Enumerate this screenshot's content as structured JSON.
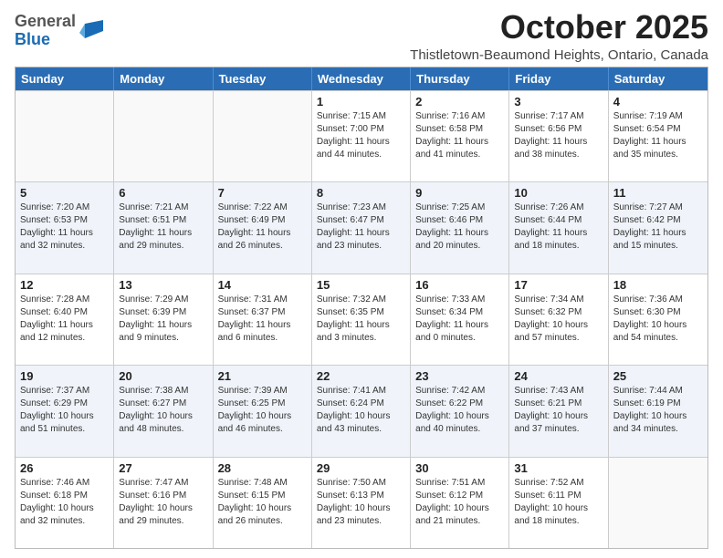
{
  "logo": {
    "general": "General",
    "blue": "Blue"
  },
  "title": "October 2025",
  "location": "Thistletown-Beaumond Heights, Ontario, Canada",
  "days_of_week": [
    "Sunday",
    "Monday",
    "Tuesday",
    "Wednesday",
    "Thursday",
    "Friday",
    "Saturday"
  ],
  "weeks": [
    [
      {
        "day": "",
        "info": ""
      },
      {
        "day": "",
        "info": ""
      },
      {
        "day": "",
        "info": ""
      },
      {
        "day": "1",
        "info": "Sunrise: 7:15 AM\nSunset: 7:00 PM\nDaylight: 11 hours and 44 minutes."
      },
      {
        "day": "2",
        "info": "Sunrise: 7:16 AM\nSunset: 6:58 PM\nDaylight: 11 hours and 41 minutes."
      },
      {
        "day": "3",
        "info": "Sunrise: 7:17 AM\nSunset: 6:56 PM\nDaylight: 11 hours and 38 minutes."
      },
      {
        "day": "4",
        "info": "Sunrise: 7:19 AM\nSunset: 6:54 PM\nDaylight: 11 hours and 35 minutes."
      }
    ],
    [
      {
        "day": "5",
        "info": "Sunrise: 7:20 AM\nSunset: 6:53 PM\nDaylight: 11 hours and 32 minutes."
      },
      {
        "day": "6",
        "info": "Sunrise: 7:21 AM\nSunset: 6:51 PM\nDaylight: 11 hours and 29 minutes."
      },
      {
        "day": "7",
        "info": "Sunrise: 7:22 AM\nSunset: 6:49 PM\nDaylight: 11 hours and 26 minutes."
      },
      {
        "day": "8",
        "info": "Sunrise: 7:23 AM\nSunset: 6:47 PM\nDaylight: 11 hours and 23 minutes."
      },
      {
        "day": "9",
        "info": "Sunrise: 7:25 AM\nSunset: 6:46 PM\nDaylight: 11 hours and 20 minutes."
      },
      {
        "day": "10",
        "info": "Sunrise: 7:26 AM\nSunset: 6:44 PM\nDaylight: 11 hours and 18 minutes."
      },
      {
        "day": "11",
        "info": "Sunrise: 7:27 AM\nSunset: 6:42 PM\nDaylight: 11 hours and 15 minutes."
      }
    ],
    [
      {
        "day": "12",
        "info": "Sunrise: 7:28 AM\nSunset: 6:40 PM\nDaylight: 11 hours and 12 minutes."
      },
      {
        "day": "13",
        "info": "Sunrise: 7:29 AM\nSunset: 6:39 PM\nDaylight: 11 hours and 9 minutes."
      },
      {
        "day": "14",
        "info": "Sunrise: 7:31 AM\nSunset: 6:37 PM\nDaylight: 11 hours and 6 minutes."
      },
      {
        "day": "15",
        "info": "Sunrise: 7:32 AM\nSunset: 6:35 PM\nDaylight: 11 hours and 3 minutes."
      },
      {
        "day": "16",
        "info": "Sunrise: 7:33 AM\nSunset: 6:34 PM\nDaylight: 11 hours and 0 minutes."
      },
      {
        "day": "17",
        "info": "Sunrise: 7:34 AM\nSunset: 6:32 PM\nDaylight: 10 hours and 57 minutes."
      },
      {
        "day": "18",
        "info": "Sunrise: 7:36 AM\nSunset: 6:30 PM\nDaylight: 10 hours and 54 minutes."
      }
    ],
    [
      {
        "day": "19",
        "info": "Sunrise: 7:37 AM\nSunset: 6:29 PM\nDaylight: 10 hours and 51 minutes."
      },
      {
        "day": "20",
        "info": "Sunrise: 7:38 AM\nSunset: 6:27 PM\nDaylight: 10 hours and 48 minutes."
      },
      {
        "day": "21",
        "info": "Sunrise: 7:39 AM\nSunset: 6:25 PM\nDaylight: 10 hours and 46 minutes."
      },
      {
        "day": "22",
        "info": "Sunrise: 7:41 AM\nSunset: 6:24 PM\nDaylight: 10 hours and 43 minutes."
      },
      {
        "day": "23",
        "info": "Sunrise: 7:42 AM\nSunset: 6:22 PM\nDaylight: 10 hours and 40 minutes."
      },
      {
        "day": "24",
        "info": "Sunrise: 7:43 AM\nSunset: 6:21 PM\nDaylight: 10 hours and 37 minutes."
      },
      {
        "day": "25",
        "info": "Sunrise: 7:44 AM\nSunset: 6:19 PM\nDaylight: 10 hours and 34 minutes."
      }
    ],
    [
      {
        "day": "26",
        "info": "Sunrise: 7:46 AM\nSunset: 6:18 PM\nDaylight: 10 hours and 32 minutes."
      },
      {
        "day": "27",
        "info": "Sunrise: 7:47 AM\nSunset: 6:16 PM\nDaylight: 10 hours and 29 minutes."
      },
      {
        "day": "28",
        "info": "Sunrise: 7:48 AM\nSunset: 6:15 PM\nDaylight: 10 hours and 26 minutes."
      },
      {
        "day": "29",
        "info": "Sunrise: 7:50 AM\nSunset: 6:13 PM\nDaylight: 10 hours and 23 minutes."
      },
      {
        "day": "30",
        "info": "Sunrise: 7:51 AM\nSunset: 6:12 PM\nDaylight: 10 hours and 21 minutes."
      },
      {
        "day": "31",
        "info": "Sunrise: 7:52 AM\nSunset: 6:11 PM\nDaylight: 10 hours and 18 minutes."
      },
      {
        "day": "",
        "info": ""
      }
    ]
  ]
}
